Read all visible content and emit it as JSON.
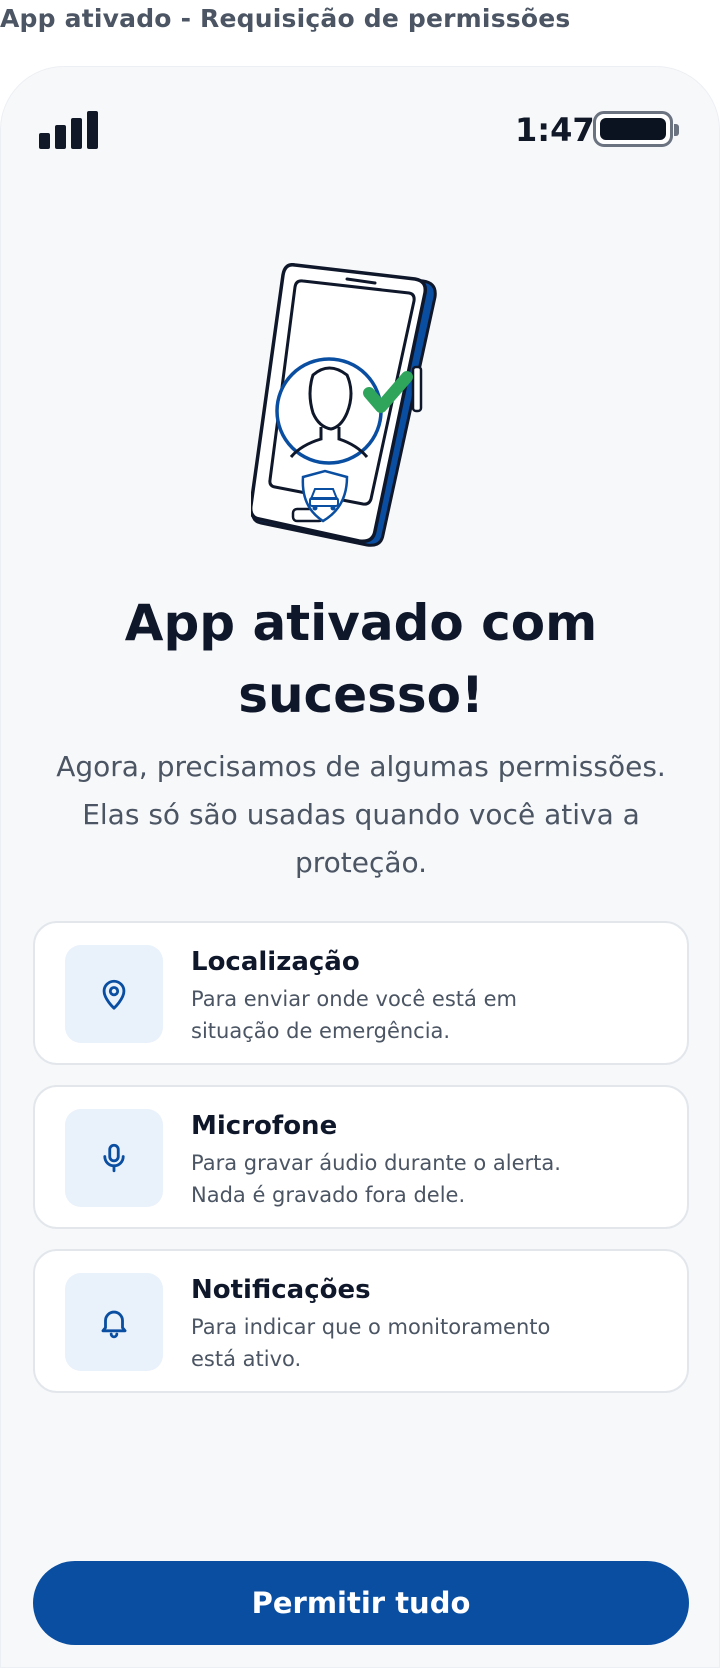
{
  "page": {
    "caption": "App ativado - Requisição de permissões"
  },
  "status_bar": {
    "time": "1:47"
  },
  "main": {
    "title": "App ativado com sucesso!",
    "subtitle": "Agora, precisamos de algumas permissões. Elas só são usadas quando você ativa a proteção."
  },
  "permissions": [
    {
      "icon": "location-pin-icon",
      "title": "Localização",
      "description": "Para enviar onde você está em situação de emergência."
    },
    {
      "icon": "microphone-icon",
      "title": "Microfone",
      "description": "Para gravar áudio durante o alerta. Nada é gravado fora dele."
    },
    {
      "icon": "bell-icon",
      "title": "Notificações",
      "description": "Para indicar que o monitoramento está ativo."
    }
  ],
  "cta": {
    "label": "Permitir tudo"
  },
  "colors": {
    "primary": "#0A4EA1",
    "success": "#2EA55B",
    "background": "#F7F8FA",
    "icon_bg": "#E9F1FB"
  }
}
